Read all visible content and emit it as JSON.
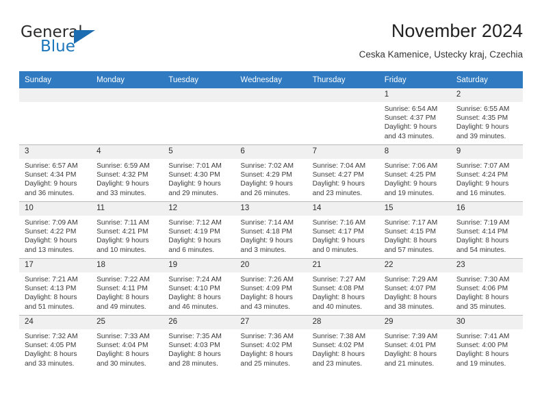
{
  "brand": {
    "name_part1": "General",
    "name_part2": "Blue",
    "logo_icon": "triangle-logo-icon",
    "accent_color": "#1b76bb"
  },
  "header": {
    "title": "November 2024",
    "subtitle": "Ceska Kamenice, Ustecky kraj, Czechia"
  },
  "calendar": {
    "header_bg_color": "#2f7ac0",
    "daynum_bg_color": "#f0f0f0",
    "weekday_headers": [
      "Sunday",
      "Monday",
      "Tuesday",
      "Wednesday",
      "Thursday",
      "Friday",
      "Saturday"
    ],
    "weeks": [
      [
        {
          "day": "",
          "lines": []
        },
        {
          "day": "",
          "lines": []
        },
        {
          "day": "",
          "lines": []
        },
        {
          "day": "",
          "lines": []
        },
        {
          "day": "",
          "lines": []
        },
        {
          "day": "1",
          "lines": [
            "Sunrise: 6:54 AM",
            "Sunset: 4:37 PM",
            "Daylight: 9 hours",
            "and 43 minutes."
          ]
        },
        {
          "day": "2",
          "lines": [
            "Sunrise: 6:55 AM",
            "Sunset: 4:35 PM",
            "Daylight: 9 hours",
            "and 39 minutes."
          ]
        }
      ],
      [
        {
          "day": "3",
          "lines": [
            "Sunrise: 6:57 AM",
            "Sunset: 4:34 PM",
            "Daylight: 9 hours",
            "and 36 minutes."
          ]
        },
        {
          "day": "4",
          "lines": [
            "Sunrise: 6:59 AM",
            "Sunset: 4:32 PM",
            "Daylight: 9 hours",
            "and 33 minutes."
          ]
        },
        {
          "day": "5",
          "lines": [
            "Sunrise: 7:01 AM",
            "Sunset: 4:30 PM",
            "Daylight: 9 hours",
            "and 29 minutes."
          ]
        },
        {
          "day": "6",
          "lines": [
            "Sunrise: 7:02 AM",
            "Sunset: 4:29 PM",
            "Daylight: 9 hours",
            "and 26 minutes."
          ]
        },
        {
          "day": "7",
          "lines": [
            "Sunrise: 7:04 AM",
            "Sunset: 4:27 PM",
            "Daylight: 9 hours",
            "and 23 minutes."
          ]
        },
        {
          "day": "8",
          "lines": [
            "Sunrise: 7:06 AM",
            "Sunset: 4:25 PM",
            "Daylight: 9 hours",
            "and 19 minutes."
          ]
        },
        {
          "day": "9",
          "lines": [
            "Sunrise: 7:07 AM",
            "Sunset: 4:24 PM",
            "Daylight: 9 hours",
            "and 16 minutes."
          ]
        }
      ],
      [
        {
          "day": "10",
          "lines": [
            "Sunrise: 7:09 AM",
            "Sunset: 4:22 PM",
            "Daylight: 9 hours",
            "and 13 minutes."
          ]
        },
        {
          "day": "11",
          "lines": [
            "Sunrise: 7:11 AM",
            "Sunset: 4:21 PM",
            "Daylight: 9 hours",
            "and 10 minutes."
          ]
        },
        {
          "day": "12",
          "lines": [
            "Sunrise: 7:12 AM",
            "Sunset: 4:19 PM",
            "Daylight: 9 hours",
            "and 6 minutes."
          ]
        },
        {
          "day": "13",
          "lines": [
            "Sunrise: 7:14 AM",
            "Sunset: 4:18 PM",
            "Daylight: 9 hours",
            "and 3 minutes."
          ]
        },
        {
          "day": "14",
          "lines": [
            "Sunrise: 7:16 AM",
            "Sunset: 4:17 PM",
            "Daylight: 9 hours",
            "and 0 minutes."
          ]
        },
        {
          "day": "15",
          "lines": [
            "Sunrise: 7:17 AM",
            "Sunset: 4:15 PM",
            "Daylight: 8 hours",
            "and 57 minutes."
          ]
        },
        {
          "day": "16",
          "lines": [
            "Sunrise: 7:19 AM",
            "Sunset: 4:14 PM",
            "Daylight: 8 hours",
            "and 54 minutes."
          ]
        }
      ],
      [
        {
          "day": "17",
          "lines": [
            "Sunrise: 7:21 AM",
            "Sunset: 4:13 PM",
            "Daylight: 8 hours",
            "and 51 minutes."
          ]
        },
        {
          "day": "18",
          "lines": [
            "Sunrise: 7:22 AM",
            "Sunset: 4:11 PM",
            "Daylight: 8 hours",
            "and 49 minutes."
          ]
        },
        {
          "day": "19",
          "lines": [
            "Sunrise: 7:24 AM",
            "Sunset: 4:10 PM",
            "Daylight: 8 hours",
            "and 46 minutes."
          ]
        },
        {
          "day": "20",
          "lines": [
            "Sunrise: 7:26 AM",
            "Sunset: 4:09 PM",
            "Daylight: 8 hours",
            "and 43 minutes."
          ]
        },
        {
          "day": "21",
          "lines": [
            "Sunrise: 7:27 AM",
            "Sunset: 4:08 PM",
            "Daylight: 8 hours",
            "and 40 minutes."
          ]
        },
        {
          "day": "22",
          "lines": [
            "Sunrise: 7:29 AM",
            "Sunset: 4:07 PM",
            "Daylight: 8 hours",
            "and 38 minutes."
          ]
        },
        {
          "day": "23",
          "lines": [
            "Sunrise: 7:30 AM",
            "Sunset: 4:06 PM",
            "Daylight: 8 hours",
            "and 35 minutes."
          ]
        }
      ],
      [
        {
          "day": "24",
          "lines": [
            "Sunrise: 7:32 AM",
            "Sunset: 4:05 PM",
            "Daylight: 8 hours",
            "and 33 minutes."
          ]
        },
        {
          "day": "25",
          "lines": [
            "Sunrise: 7:33 AM",
            "Sunset: 4:04 PM",
            "Daylight: 8 hours",
            "and 30 minutes."
          ]
        },
        {
          "day": "26",
          "lines": [
            "Sunrise: 7:35 AM",
            "Sunset: 4:03 PM",
            "Daylight: 8 hours",
            "and 28 minutes."
          ]
        },
        {
          "day": "27",
          "lines": [
            "Sunrise: 7:36 AM",
            "Sunset: 4:02 PM",
            "Daylight: 8 hours",
            "and 25 minutes."
          ]
        },
        {
          "day": "28",
          "lines": [
            "Sunrise: 7:38 AM",
            "Sunset: 4:02 PM",
            "Daylight: 8 hours",
            "and 23 minutes."
          ]
        },
        {
          "day": "29",
          "lines": [
            "Sunrise: 7:39 AM",
            "Sunset: 4:01 PM",
            "Daylight: 8 hours",
            "and 21 minutes."
          ]
        },
        {
          "day": "30",
          "lines": [
            "Sunrise: 7:41 AM",
            "Sunset: 4:00 PM",
            "Daylight: 8 hours",
            "and 19 minutes."
          ]
        }
      ]
    ]
  }
}
